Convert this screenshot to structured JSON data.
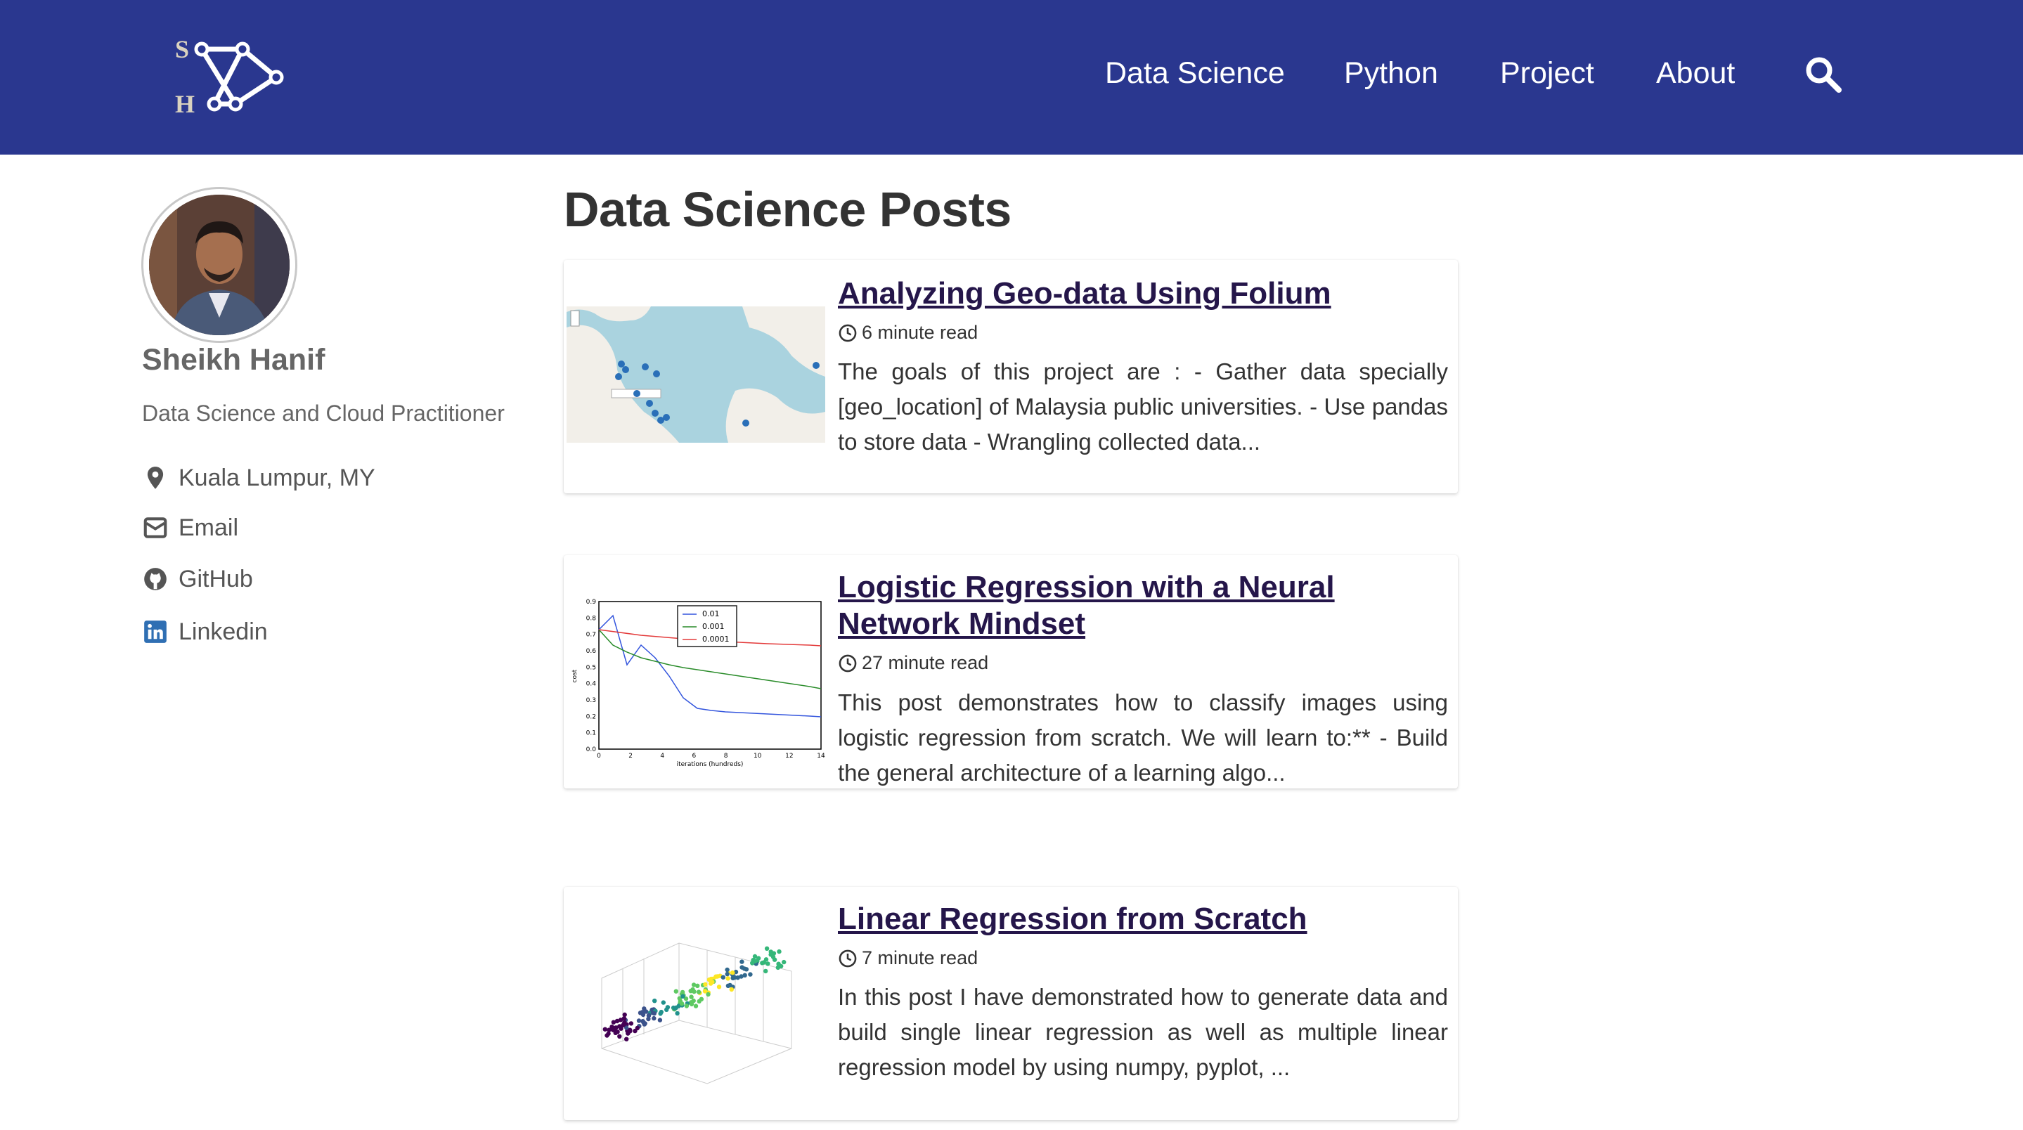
{
  "header": {
    "logo_text_top": "S",
    "logo_text_bottom": "H",
    "nav": [
      {
        "label": "Data Science"
      },
      {
        "label": "Python"
      },
      {
        "label": "Project"
      },
      {
        "label": "About"
      }
    ],
    "bg_color": "#2a378f"
  },
  "sidebar": {
    "name": "Sheikh Hanif",
    "bio": "Data Science and Cloud Practitioner",
    "links": [
      {
        "icon": "location-pin-icon",
        "label": "Kuala Lumpur, MY"
      },
      {
        "icon": "email-icon",
        "label": "Email"
      },
      {
        "icon": "github-icon",
        "label": "GitHub"
      },
      {
        "icon": "linkedin-icon",
        "label": "Linkedin"
      }
    ]
  },
  "main": {
    "title": "Data Science Posts",
    "posts": [
      {
        "title": "Analyzing Geo-data Using Folium",
        "read_time": "6 minute read",
        "excerpt": "The goals of this project are : - Gather data specially [geo_location] of Malaysia public universities. - Use pandas to store data - Wrangling collected data..."
      },
      {
        "title": "Logistic Regression with a Neural Network Mindset",
        "read_time": "27 minute read",
        "excerpt": "This post demonstrates how to classify images using logistic regression from scratch. We will learn to:** - Build the general architecture of a learning algo...",
        "thumb": {
          "legend": [
            "0.01",
            "0.001",
            "0.0001"
          ],
          "xlabel": "iterations (hundreds)",
          "ylabel": "cost",
          "yticks": [
            "0.9",
            "0.8",
            "0.7",
            "0.6",
            "0.5",
            "0.4",
            "0.3",
            "0.2",
            "0.1",
            "0.0"
          ],
          "xticks": [
            "0",
            "2",
            "4",
            "6",
            "8",
            "10",
            "12",
            "14"
          ]
        }
      },
      {
        "title": "Linear Regression from Scratch",
        "read_time": "7 minute read",
        "excerpt": "In this post I have demonstrated how to generate data and build single linear regression as well as multiple linear regression model by using numpy, pyplot, ..."
      }
    ]
  },
  "colors": {
    "title_link": "#25164a",
    "linkedin": "#2f6fb3"
  }
}
